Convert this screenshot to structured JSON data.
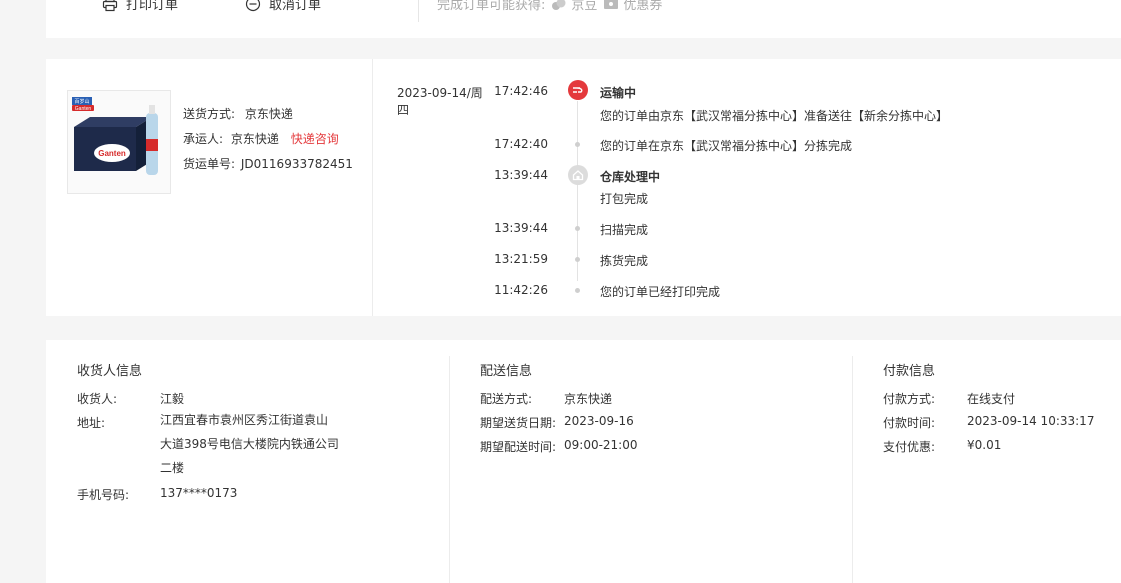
{
  "top": {
    "print_label": "打印订单",
    "cancel_label": "取消订单",
    "rewards_label": "完成订单可能获得:",
    "rewards": [
      "京豆",
      "优惠券"
    ]
  },
  "shipping": {
    "method_label": "送货方式:",
    "method_value": "京东快递",
    "carrier_label": "承运人:",
    "carrier_value": "京东快递",
    "consult_link": "快递咨询",
    "tracking_label": "货运单号:",
    "tracking_value": "JD0116933782451",
    "product_brand": "百岁山",
    "product_brand_latin": "Ganten"
  },
  "tracking": {
    "date": "2023-09-14/周四",
    "events": [
      {
        "time": "17:42:46",
        "title": "运输中",
        "desc": "您的订单由京东【武汉常福分拣中心】准备送往【新余分拣中心】"
      },
      {
        "time": "17:42:40",
        "title": "",
        "desc": "您的订单在京东【武汉常福分拣中心】分拣完成"
      },
      {
        "time": "13:39:44",
        "title": "仓库处理中",
        "desc": "打包完成"
      },
      {
        "time": "13:39:44",
        "title": "",
        "desc": "扫描完成"
      },
      {
        "time": "13:21:59",
        "title": "",
        "desc": "拣货完成"
      },
      {
        "time": "11:42:26",
        "title": "",
        "desc": "您的订单已经打印完成"
      }
    ]
  },
  "receiver": {
    "title": "收货人信息",
    "name_label": "收货人:",
    "name_value": "江毅",
    "address_label": "地址:",
    "address_lines": [
      "江西宜春市袁州区秀江街道袁山",
      "大道398号电信大楼院内铁通公司",
      "二楼"
    ],
    "phone_label": "手机号码:",
    "phone_value": "137****0173"
  },
  "delivery": {
    "title": "配送信息",
    "method_label": "配送方式:",
    "method_value": "京东快递",
    "date_label": "期望送货日期:",
    "date_value": "2023-09-16",
    "time_label": "期望配送时间:",
    "time_value": "09:00-21:00"
  },
  "payment": {
    "title": "付款信息",
    "method_label": "付款方式:",
    "method_value": "在线支付",
    "time_label": "付款时间:",
    "time_value": "2023-09-14 10:33:17",
    "discount_label": "支付优惠:",
    "discount_value": "¥0.01"
  },
  "colors": {
    "accent": "#e4393c",
    "muted": "#aaaaaa",
    "border": "#ececec"
  }
}
